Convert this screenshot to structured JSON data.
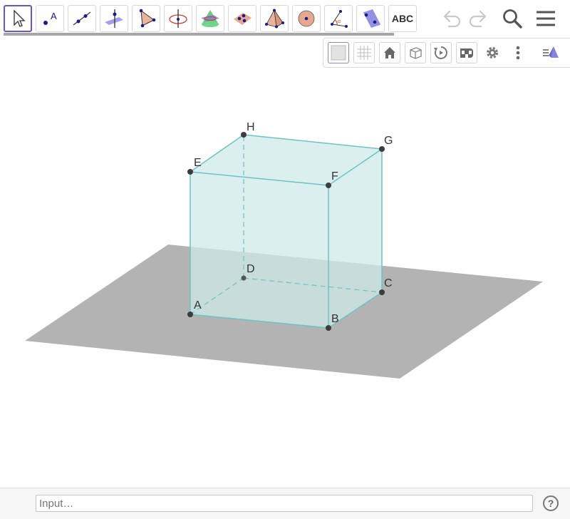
{
  "toolbar": {
    "tools": [
      {
        "name": "move-tool",
        "icon": "arrow-cursor-icon"
      },
      {
        "name": "point-tool",
        "icon": "point-icon",
        "glyph": "A"
      },
      {
        "name": "line-tool",
        "icon": "line-icon"
      },
      {
        "name": "perpendicular-line-tool",
        "icon": "perpendicular-line-icon"
      },
      {
        "name": "polygon-tool",
        "icon": "polygon-icon"
      },
      {
        "name": "circle-axis-tool",
        "icon": "circle-around-axis-icon"
      },
      {
        "name": "intersect-surfaces-tool",
        "icon": "intersect-surfaces-icon"
      },
      {
        "name": "plane-three-points-tool",
        "icon": "plane-through-points-icon"
      },
      {
        "name": "pyramid-tool",
        "icon": "pyramid-icon"
      },
      {
        "name": "sphere-tool",
        "icon": "sphere-icon"
      },
      {
        "name": "angle-tool",
        "icon": "angle-icon"
      },
      {
        "name": "reflect-plane-tool",
        "icon": "reflect-about-plane-icon"
      },
      {
        "name": "text-tool",
        "label": "ABC"
      }
    ],
    "right_icons": [
      "undo-icon",
      "redo-icon",
      "search-icon",
      "menu-icon"
    ]
  },
  "stylebar": {
    "buttons": [
      "background-square-icon",
      "grid-icon",
      "home-icon",
      "view-direction-cube-icon",
      "rotate-view-icon",
      "stereo-glasses-icon",
      "settings-gear-icon",
      "more-options-icon",
      "toggle-style-bar-icon"
    ]
  },
  "view3d": {
    "labels": {
      "A": "A",
      "B": "B",
      "C": "C",
      "D": "D",
      "E": "E",
      "F": "F",
      "G": "G",
      "H": "H"
    },
    "colors": {
      "plane": "#b3b3b3",
      "cube_face": "#cfe9ea",
      "cube_edge": "#6cc3c5",
      "point": "#3d3d3d"
    }
  },
  "inputbar": {
    "placeholder": "Input…",
    "help_label": "?"
  }
}
